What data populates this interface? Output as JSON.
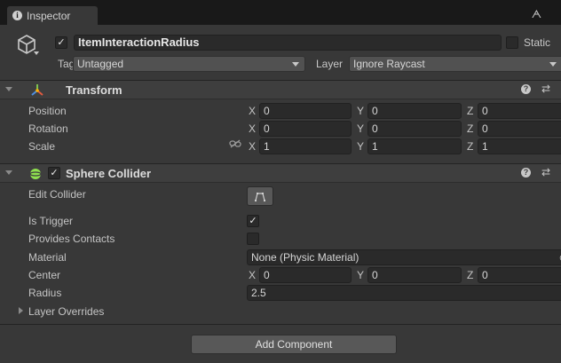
{
  "tab": {
    "title": "Inspector",
    "info_icon": "i"
  },
  "header": {
    "object_name": "ItemInteractionRadius",
    "active_checked": true,
    "static_label": "Static",
    "tag_label": "Tag",
    "tag_value": "Untagged",
    "layer_label": "Layer",
    "layer_value": "Ignore Raycast"
  },
  "transform": {
    "title": "Transform",
    "rows": [
      {
        "label": "Position",
        "x": "0",
        "y": "0",
        "z": "0"
      },
      {
        "label": "Rotation",
        "x": "0",
        "y": "0",
        "z": "0"
      },
      {
        "label": "Scale",
        "x": "1",
        "y": "1",
        "z": "1"
      }
    ],
    "axis_labels": {
      "x": "X",
      "y": "Y",
      "z": "Z"
    }
  },
  "sphere_collider": {
    "title": "Sphere Collider",
    "enabled": true,
    "edit_collider_label": "Edit Collider",
    "is_trigger_label": "Is Trigger",
    "is_trigger_checked": true,
    "provides_contacts_label": "Provides Contacts",
    "provides_contacts_checked": false,
    "material_label": "Material",
    "material_value": "None (Physic Material)",
    "center_label": "Center",
    "center": {
      "x": "0",
      "y": "0",
      "z": "0"
    },
    "radius_label": "Radius",
    "radius_value": "2.5",
    "layer_overrides_label": "Layer Overrides"
  },
  "add_component_label": "Add Component",
  "glyphs": {
    "check": "✓",
    "help": "?",
    "settings": "⇄",
    "lock": "ᗅ"
  },
  "colors": {
    "accent_yellow": "#ffb000",
    "sphere_green": "#8fe04f"
  }
}
